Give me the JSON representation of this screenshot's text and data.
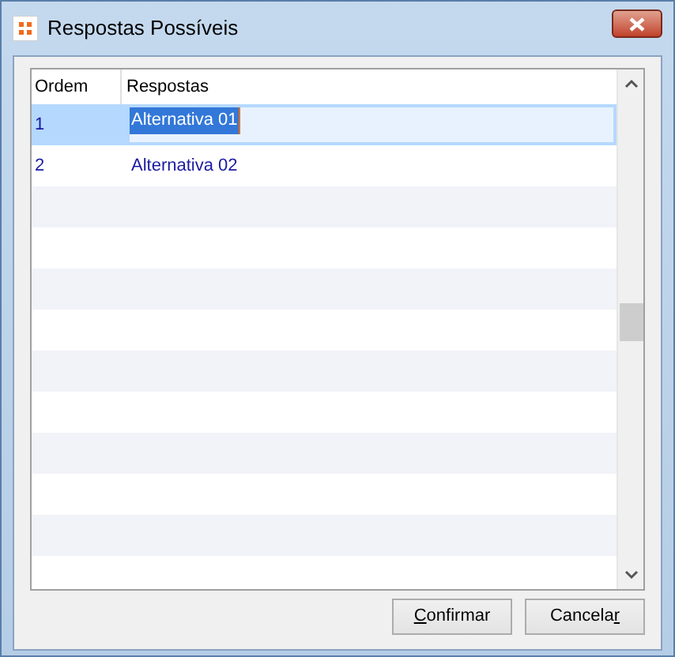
{
  "window": {
    "title": "Respostas Possíveis"
  },
  "table": {
    "columns": [
      "Ordem",
      "Respostas"
    ],
    "rows": [
      {
        "cells": [
          "1",
          "Alternativa 01"
        ],
        "selected": true,
        "editing": true
      },
      {
        "cells": [
          "2",
          "Alternativa 02"
        ],
        "selected": false,
        "editing": false
      }
    ]
  },
  "buttons": [
    {
      "mnemonic": "C",
      "label_after": "onfirmar"
    },
    {
      "label_before": "Cancela",
      "mnemonic": "r"
    }
  ]
}
